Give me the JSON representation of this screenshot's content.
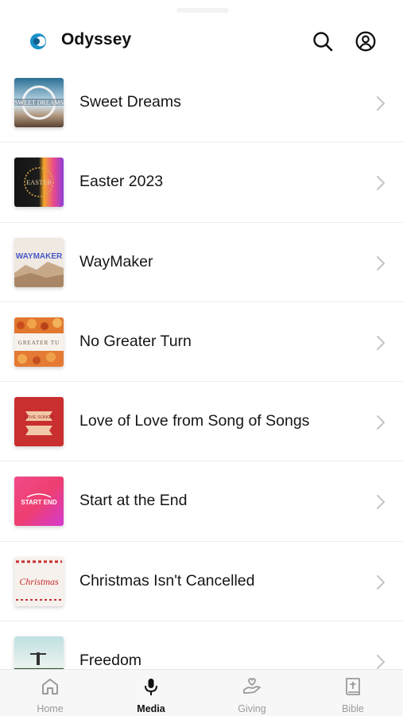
{
  "header": {
    "brand": "Odyssey",
    "logo_icon": "odyssey-logo-icon",
    "search_icon": "search-icon",
    "account_icon": "account-icon",
    "accent_color": "#1a8fc9"
  },
  "media_list": {
    "items": [
      {
        "title": "Sweet Dreams",
        "thumb_text": "SWEET DREAMS"
      },
      {
        "title": "Easter 2023",
        "thumb_text": "EASTER"
      },
      {
        "title": "WayMaker",
        "thumb_text": "WAYMAKER"
      },
      {
        "title": "No Greater Turn",
        "thumb_text": "GREATER TU"
      },
      {
        "title": "Love of Love from Song of Songs",
        "thumb_text": "LOVE SONGS"
      },
      {
        "title": "Start at the End",
        "thumb_text": "START END"
      },
      {
        "title": "Christmas Isn't Cancelled",
        "thumb_text": "Christmas"
      },
      {
        "title": "Freedom",
        "thumb_text": ""
      }
    ]
  },
  "tabbar": {
    "tabs": [
      {
        "label": "Home",
        "icon": "home-icon",
        "active": false
      },
      {
        "label": "Media",
        "icon": "microphone-icon",
        "active": true
      },
      {
        "label": "Giving",
        "icon": "giving-hand-heart-icon",
        "active": false
      },
      {
        "label": "Bible",
        "icon": "bible-book-icon",
        "active": false
      }
    ]
  }
}
